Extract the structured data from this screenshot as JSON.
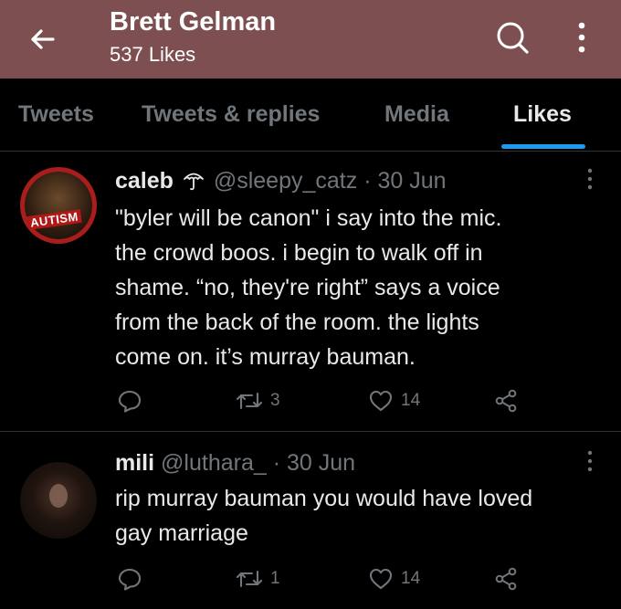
{
  "header": {
    "title": "Brett Gelman",
    "subtitle": "537 Likes"
  },
  "tabs": [
    {
      "label": "Tweets"
    },
    {
      "label": "Tweets & replies"
    },
    {
      "label": "Media"
    },
    {
      "label": "Likes",
      "active": true
    }
  ],
  "colors": {
    "header_bg": "#7e4f51",
    "accent": "#1d9bf0",
    "background": "#000000",
    "muted": "#71767b"
  },
  "tweets": [
    {
      "name": "caleb",
      "name_emoji": "umbrella-icon",
      "handle": "@sleepy_catz",
      "separator": "·",
      "date": "30 Jun",
      "avatar_badge": "AUTISM",
      "text_lines": [
        "\"byler will be canon\" i say into the mic.",
        "the crowd boos. i begin to walk off in",
        "shame. “no, they're right” says a voice",
        "from the back of the room. the lights",
        "come on. it’s murray bauman."
      ],
      "retweets": "3",
      "likes": "14"
    },
    {
      "name": "mili",
      "handle": "@luthara_",
      "separator": "·",
      "date": "30 Jun",
      "text_lines": [
        "rip murray bauman you would have loved",
        "gay marriage"
      ],
      "retweets": "1",
      "likes": "14"
    }
  ]
}
